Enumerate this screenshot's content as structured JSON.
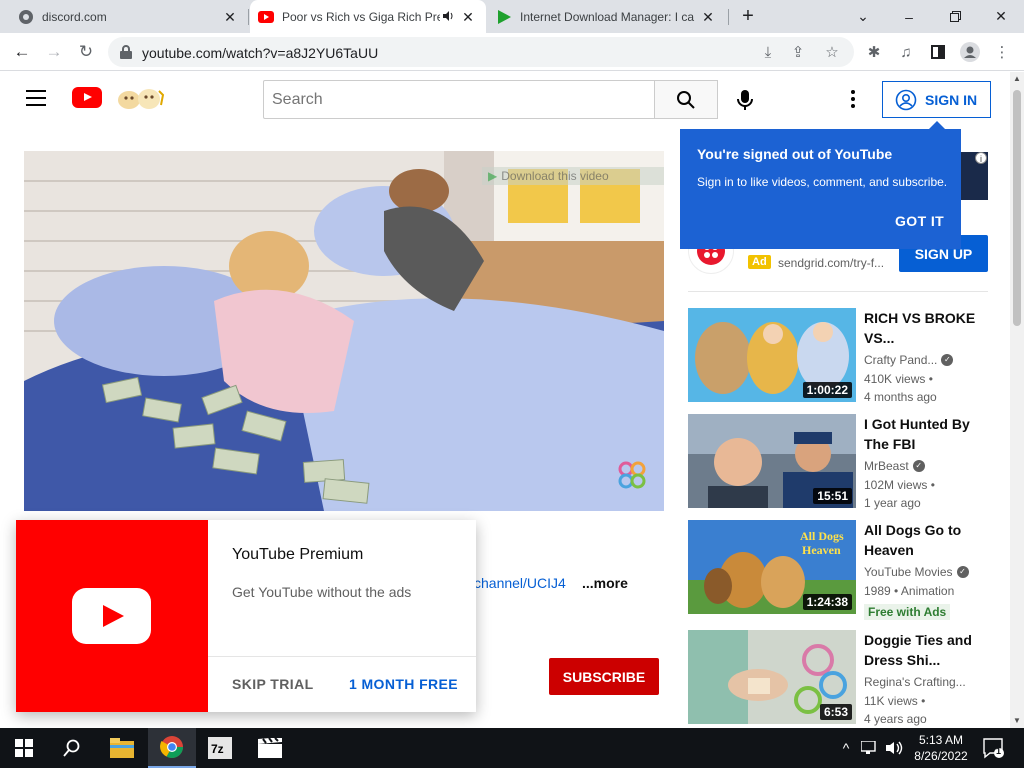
{
  "browser": {
    "tabs": [
      {
        "title": "discord.com",
        "favicon": "globe-icon"
      },
      {
        "title": "Poor vs Rich vs Giga Rich Pre",
        "favicon": "youtube-icon",
        "audio": true
      },
      {
        "title": "Internet Download Manager: I ca",
        "favicon": "idm-icon"
      }
    ],
    "url": "youtube.com/watch?v=a8J2YU6TaUU"
  },
  "header": {
    "search_placeholder": "Search",
    "sign_in_label": "SIGN IN"
  },
  "player": {
    "idm_label": "Download this video",
    "idm_help": "?",
    "idm_close": "×"
  },
  "description": {
    "channel_link": "channel/UCIJ4",
    "more_label": "...more"
  },
  "subscribe_label": "SUBSCRIBE",
  "premium": {
    "title": "YouTube Premium",
    "subtitle": "Get YouTube without the ads",
    "skip_label": "SKIP TRIAL",
    "month_label": "1 MONTH FREE"
  },
  "popover": {
    "title": "You're signed out of YouTube",
    "text": "Sign in to like videos, comment, and subscribe.",
    "button": "GOT IT"
  },
  "ad": {
    "badge": "Ad",
    "url": "sendgrid.com/try-f...",
    "cta": "SIGN UP"
  },
  "related": [
    {
      "title": "RICH VS BROKE VS...",
      "channel": "Crafty Pand...",
      "verified": true,
      "meta1": "410K views •",
      "meta2": "4 months ago",
      "duration": "1:00:22"
    },
    {
      "title": "I Got Hunted By The FBI",
      "channel": "MrBeast",
      "verified": true,
      "meta1": "102M views •",
      "meta2": "1 year ago",
      "duration": "15:51"
    },
    {
      "title": "All Dogs Go to Heaven",
      "channel": "YouTube Movies",
      "verified": true,
      "meta1": "1989 • Animation",
      "badge": "Free with Ads",
      "duration": "1:24:38"
    },
    {
      "title": "Doggie Ties and Dress Shi...",
      "channel": "Regina's Crafting...",
      "verified": false,
      "meta1": "11K views •",
      "meta2": "4 years ago",
      "duration": "6:53"
    }
  ],
  "taskbar": {
    "time": "5:13 AM",
    "date": "8/26/2022",
    "notification_count": "1",
    "apps": [
      "file-explorer-icon",
      "chrome-icon",
      "7zip-icon",
      "media-player-icon"
    ]
  }
}
